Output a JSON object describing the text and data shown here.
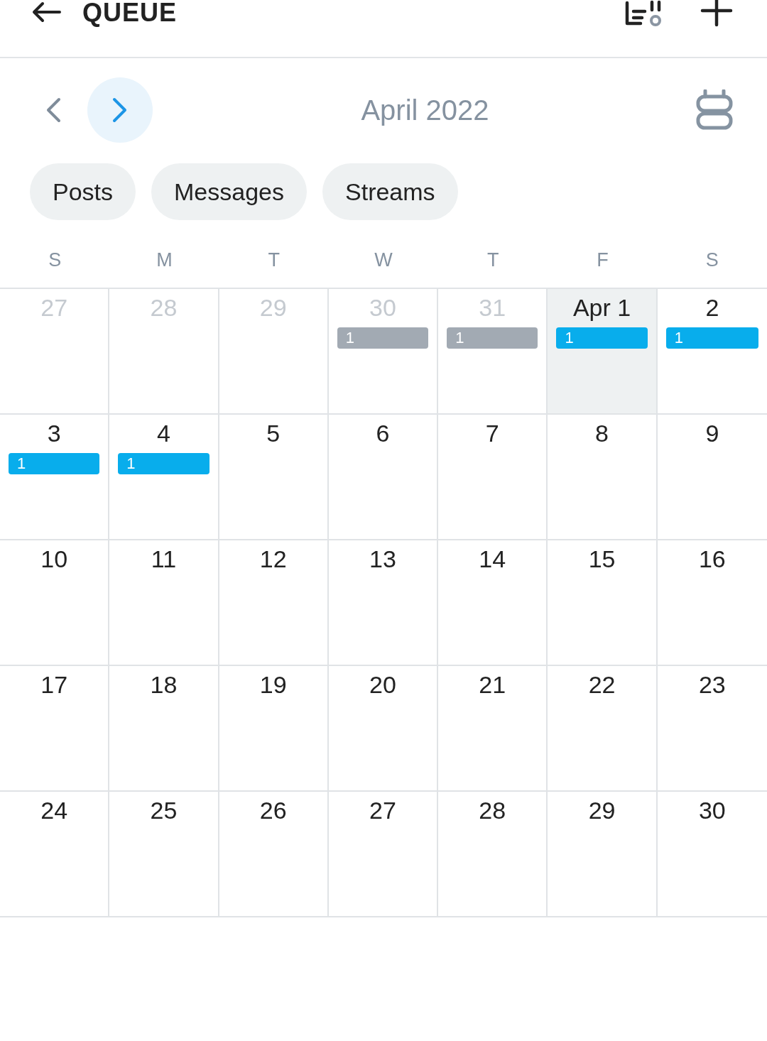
{
  "header": {
    "title": "QUEUE"
  },
  "calendar": {
    "month": "April 2022"
  },
  "filters": [
    {
      "label": "Posts"
    },
    {
      "label": "Messages"
    },
    {
      "label": "Streams"
    }
  ],
  "weekdays": [
    "S",
    "M",
    "T",
    "W",
    "T",
    "F",
    "S"
  ],
  "weeks": [
    [
      {
        "date": "27",
        "other_month": true,
        "selected": false
      },
      {
        "date": "28",
        "other_month": true,
        "selected": false
      },
      {
        "date": "29",
        "other_month": true,
        "selected": false
      },
      {
        "date": "30",
        "other_month": true,
        "selected": false,
        "events": [
          {
            "label": "1",
            "color": "#a2aab3"
          }
        ]
      },
      {
        "date": "31",
        "other_month": true,
        "selected": false,
        "events": [
          {
            "label": "1",
            "color": "#a2aab3"
          }
        ]
      },
      {
        "date": "Apr 1",
        "other_month": false,
        "selected": true,
        "events": [
          {
            "label": "1",
            "color": "#08adec"
          }
        ]
      },
      {
        "date": "2",
        "other_month": false,
        "selected": false,
        "events": [
          {
            "label": "1",
            "color": "#08adec"
          }
        ]
      }
    ],
    [
      {
        "date": "3",
        "other_month": false,
        "selected": false,
        "events": [
          {
            "label": "1",
            "color": "#08adec"
          }
        ]
      },
      {
        "date": "4",
        "other_month": false,
        "selected": false,
        "events": [
          {
            "label": "1",
            "color": "#08adec"
          }
        ]
      },
      {
        "date": "5",
        "other_month": false,
        "selected": false
      },
      {
        "date": "6",
        "other_month": false,
        "selected": false
      },
      {
        "date": "7",
        "other_month": false,
        "selected": false
      },
      {
        "date": "8",
        "other_month": false,
        "selected": false
      },
      {
        "date": "9",
        "other_month": false,
        "selected": false
      }
    ],
    [
      {
        "date": "10",
        "other_month": false,
        "selected": false
      },
      {
        "date": "11",
        "other_month": false,
        "selected": false
      },
      {
        "date": "12",
        "other_month": false,
        "selected": false
      },
      {
        "date": "13",
        "other_month": false,
        "selected": false
      },
      {
        "date": "14",
        "other_month": false,
        "selected": false
      },
      {
        "date": "15",
        "other_month": false,
        "selected": false
      },
      {
        "date": "16",
        "other_month": false,
        "selected": false
      }
    ],
    [
      {
        "date": "17",
        "other_month": false,
        "selected": false
      },
      {
        "date": "18",
        "other_month": false,
        "selected": false
      },
      {
        "date": "19",
        "other_month": false,
        "selected": false
      },
      {
        "date": "20",
        "other_month": false,
        "selected": false
      },
      {
        "date": "21",
        "other_month": false,
        "selected": false
      },
      {
        "date": "22",
        "other_month": false,
        "selected": false
      },
      {
        "date": "23",
        "other_month": false,
        "selected": false
      }
    ],
    [
      {
        "date": "24",
        "other_month": false,
        "selected": false
      },
      {
        "date": "25",
        "other_month": false,
        "selected": false
      },
      {
        "date": "26",
        "other_month": false,
        "selected": false
      },
      {
        "date": "27",
        "other_month": false,
        "selected": false
      },
      {
        "date": "28",
        "other_month": false,
        "selected": false
      },
      {
        "date": "29",
        "other_month": false,
        "selected": false
      },
      {
        "date": "30",
        "other_month": false,
        "selected": false
      }
    ]
  ]
}
